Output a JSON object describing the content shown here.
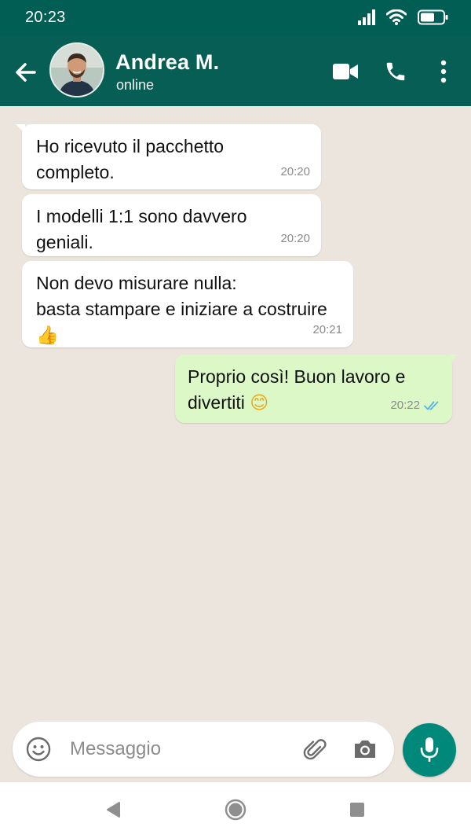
{
  "status_bar": {
    "time": "20:23",
    "icons": [
      "signal-icon",
      "wifi-icon",
      "battery-icon"
    ]
  },
  "header": {
    "contact_name": "Andrea M.",
    "contact_status": "online",
    "icons": [
      "back-arrow-icon",
      "avatar",
      "video-call-icon",
      "phone-icon",
      "more-vert-icon"
    ]
  },
  "messages": [
    {
      "direction": "in",
      "text": "Ho ricevuto il pacchetto completo.",
      "time": "20:20"
    },
    {
      "direction": "in",
      "text": "I modelli 1:1 sono davvero geniali.",
      "time": "20:20"
    },
    {
      "direction": "in",
      "text": "Non devo misurare nulla:\nbasta stampare e iniziare a costruire",
      "emoji": "👍",
      "time": "20:21"
    },
    {
      "direction": "out",
      "text": "Proprio così! Buon lavoro e\ndivertiti",
      "emoji": "😊",
      "time": "20:22",
      "status": "read"
    }
  ],
  "composer": {
    "placeholder": "Messaggio",
    "icons": [
      "emoji-icon",
      "attach-icon",
      "camera-icon",
      "mic-icon"
    ]
  },
  "colors": {
    "header": "#075e54",
    "chat_background": "#ece5dd",
    "incoming_bubble": "#ffffff",
    "outgoing_bubble": "#dcf8c6",
    "accent": "#00897b",
    "read_ticks": "#4fb6ec"
  }
}
